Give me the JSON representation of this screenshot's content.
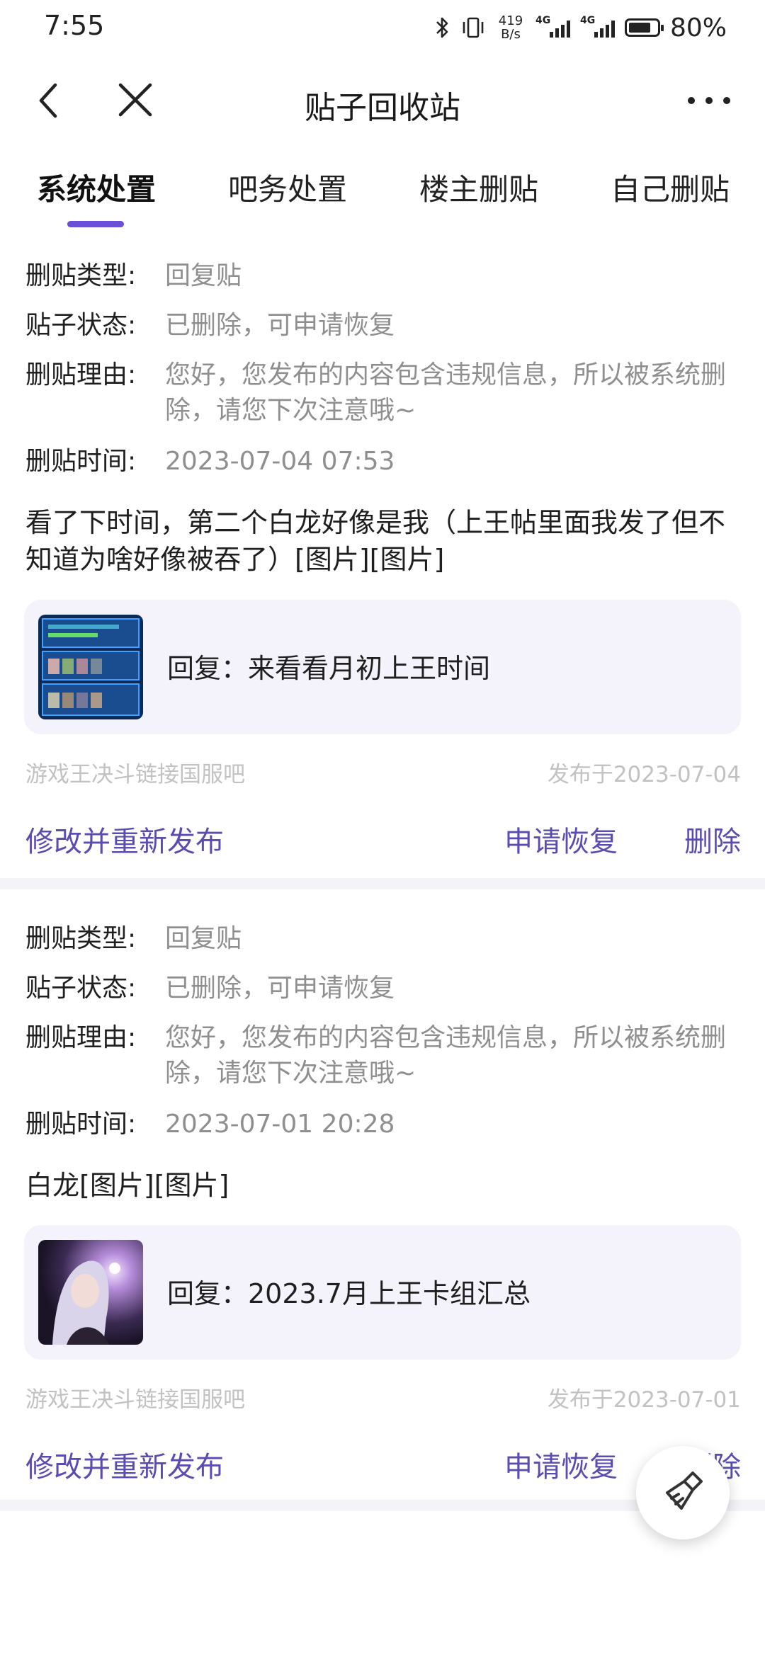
{
  "status_bar": {
    "time": "7:55",
    "net_speed_value": "419",
    "net_speed_unit": "B/s",
    "signal1_label": "4G",
    "signal2_label": "4G",
    "battery_percent_text": "80%",
    "battery_level": 0.8,
    "icons": [
      "bluetooth-icon",
      "vibrate-icon",
      "signal-icon",
      "signal-icon",
      "battery-icon"
    ]
  },
  "navbar": {
    "title": "贴子回收站",
    "back_icon": "chevron-left-icon",
    "close_icon": "close-icon",
    "more_icon": "more-horizontal-icon"
  },
  "tabs": [
    {
      "label": "系统处置",
      "active": true
    },
    {
      "label": "吧务处置",
      "active": false
    },
    {
      "label": "楼主删贴",
      "active": false
    },
    {
      "label": "自己删贴",
      "active": false
    }
  ],
  "labels": {
    "type": "删贴类型:",
    "status": "贴子状态:",
    "reason": "删贴理由:",
    "time": "删贴时间:"
  },
  "posts": [
    {
      "type": "回复贴",
      "status": "已删除，可申请恢复",
      "reason": "您好，您发布的内容包含违规信息，所以被系统删除，请您下次注意哦~",
      "time": "2023-07-04 07:53",
      "content": "看了下时间，第二个白龙好像是我（上王帖里面我发了但不知道为啥好像被吞了）[图片][图片]",
      "ref_title": "回复：来看看月初上王时间",
      "forum": "游戏王决斗链接国服吧",
      "published": "发布于2023-07-04",
      "actions": {
        "edit": "修改并重新发布",
        "restore": "申请恢复",
        "delete": "删除"
      }
    },
    {
      "type": "回复贴",
      "status": "已删除，可申请恢复",
      "reason": "您好，您发布的内容包含违规信息，所以被系统删除，请您下次注意哦~",
      "time": "2023-07-01 20:28",
      "content": "白龙[图片][图片]",
      "ref_title": "回复：2023.7月上王卡组汇总",
      "forum": "游戏王决斗链接国服吧",
      "published": "发布于2023-07-01",
      "actions": {
        "edit": "修改并重新发布",
        "restore": "申请恢复",
        "delete": "删除"
      }
    }
  ],
  "fab": {
    "icon": "broom-icon"
  },
  "colors": {
    "accent": "#6b4fd8",
    "action_text": "#5a4cb0",
    "muted": "#8f8f8f"
  }
}
